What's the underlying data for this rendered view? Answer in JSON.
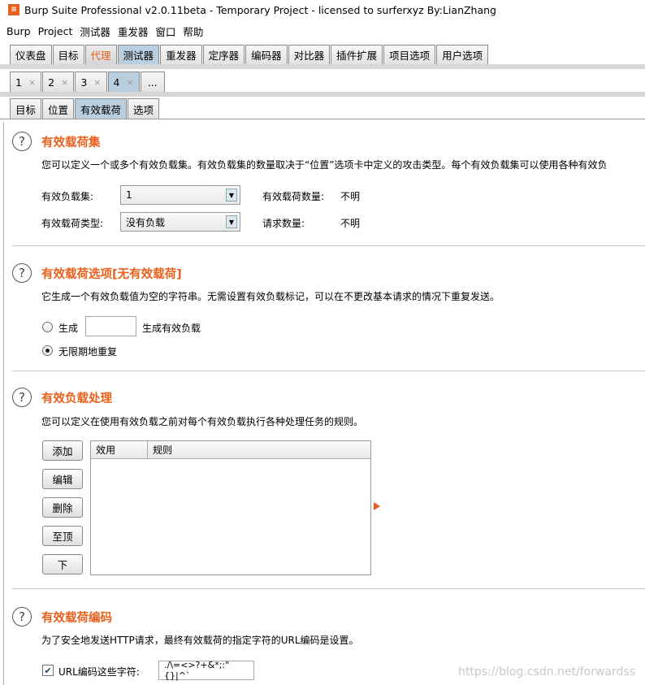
{
  "window": {
    "title": "Burp Suite Professional v2.0.11beta - Temporary Project - licensed to surferxyz By:LianZhang",
    "logo": "burp-logo-icon"
  },
  "menu": [
    "Burp",
    "Project",
    "测试器",
    "重发器",
    "窗口",
    "帮助"
  ],
  "main_tabs": [
    "仪表盘",
    "目标",
    "代理",
    "测试器",
    "重发器",
    "定序器",
    "编码器",
    "对比器",
    "插件扩展",
    "项目选项",
    "用户选项"
  ],
  "attack_tabs": [
    {
      "label": "1",
      "close": "×"
    },
    {
      "label": "2",
      "close": "×"
    },
    {
      "label": "3",
      "close": "×"
    },
    {
      "label": "4",
      "close": "×"
    }
  ],
  "attack_more": "...",
  "sub_tabs": [
    "目标",
    "位置",
    "有效载荷",
    "选项"
  ],
  "help_glyph": "?",
  "payload_sets": {
    "title": "有效载荷集",
    "description": "您可以定义一个或多个有效负载集。有效负载集的数量取决于“位置”选项卡中定义的攻击类型。每个有效负载集可以使用各种有效负",
    "set_label": "有效负载集:",
    "set_value": "1",
    "type_label": "有效载荷类型:",
    "type_value": "没有负载",
    "count_label": "有效载荷数量:",
    "count_value": "不明",
    "requests_label": "请求数量:",
    "requests_value": "不明"
  },
  "payload_options": {
    "title": "有效载荷选项[无有效载荷]",
    "description": "它生成一个有效负载值为空的字符串。无需设置有效负载标记，可以在不更改基本请求的情况下重复发送。",
    "generate_label": "生成",
    "generate_value": "",
    "generate_suffix": "生成有效负载",
    "repeat_label": "无限期地重复",
    "selected": "repeat"
  },
  "payload_processing": {
    "title": "有效负载处理",
    "description": "您可以定义在使用有效负载之前对每个有效负载执行各种处理任务的规则。",
    "buttons": [
      "添加",
      "编辑",
      "删除",
      "至顶",
      "下"
    ],
    "columns": [
      "效用",
      "规则"
    ],
    "rows": []
  },
  "payload_encoding": {
    "title": "有效载荷编码",
    "description": "为了安全地发送HTTP请求，最终有效载荷的指定字符的URL编码是设置。",
    "checkbox_label": "URL编码这些字符:",
    "checked": true,
    "chars": "./\\=<>?+&*;:\"{}|^`"
  },
  "watermark": "https://blog.csdn.net/forwardss",
  "colors": {
    "accent": "#e8601c",
    "active_tab": "#b9cfe0"
  }
}
